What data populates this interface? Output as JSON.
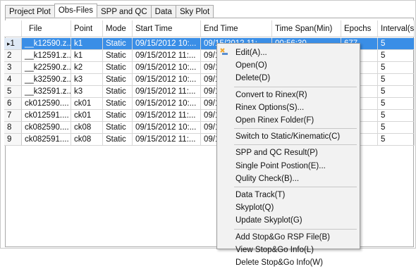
{
  "tabs": [
    {
      "label": "Project Plot",
      "active": false
    },
    {
      "label": "Obs-Files",
      "active": true
    },
    {
      "label": "SPP and QC",
      "active": false
    },
    {
      "label": "Data",
      "active": false
    },
    {
      "label": "Sky Plot",
      "active": false
    }
  ],
  "table": {
    "columns": [
      "File",
      "Point",
      "Mode",
      "Start Time",
      "End Time",
      "Time Span(Min)",
      "Epochs",
      "Interval(s)"
    ],
    "selected_row_marker": "▸",
    "rows": [
      {
        "num": "1",
        "file": "__k12590.z...",
        "point": "k1",
        "mode": "Static",
        "start": "09/15/2012 10:...",
        "end": "09/15/2012 11:...",
        "span": "00:56:30",
        "epochs": "677",
        "interval": "5"
      },
      {
        "num": "2",
        "file": "__k12591.z...",
        "point": "k1",
        "mode": "Static",
        "start": "09/15/2012 11:...",
        "end": "09/1",
        "span": "",
        "epochs": "",
        "interval": "5"
      },
      {
        "num": "3",
        "file": "__k22590.z...",
        "point": "k2",
        "mode": "Static",
        "start": "09/15/2012 10:...",
        "end": "09/1",
        "span": "",
        "epochs": "",
        "interval": "5"
      },
      {
        "num": "4",
        "file": "__k32590.z...",
        "point": "k3",
        "mode": "Static",
        "start": "09/15/2012 10:...",
        "end": "09/1",
        "span": "",
        "epochs": "",
        "interval": "5"
      },
      {
        "num": "5",
        "file": "__k32591.z...",
        "point": "k3",
        "mode": "Static",
        "start": "09/15/2012 11:...",
        "end": "09/1",
        "span": "",
        "epochs": "",
        "interval": "5"
      },
      {
        "num": "6",
        "file": "ck012590....",
        "point": "ck01",
        "mode": "Static",
        "start": "09/15/2012 10:...",
        "end": "09/1",
        "span": "",
        "epochs": "",
        "interval": "5"
      },
      {
        "num": "7",
        "file": "ck012591....",
        "point": "ck01",
        "mode": "Static",
        "start": "09/15/2012 11:...",
        "end": "09/1",
        "span": "",
        "epochs": "",
        "interval": "5"
      },
      {
        "num": "8",
        "file": "ck082590....",
        "point": "ck08",
        "mode": "Static",
        "start": "09/15/2012 10:...",
        "end": "09/1",
        "span": "",
        "epochs": "",
        "interval": "5"
      },
      {
        "num": "9",
        "file": "ck082591....",
        "point": "ck08",
        "mode": "Static",
        "start": "09/15/2012 11:...",
        "end": "09/1",
        "span": "",
        "epochs": "",
        "interval": "5"
      }
    ]
  },
  "context_menu": {
    "icon": "edit-icon",
    "groups": [
      [
        "Edit(A)...",
        "Open(O)",
        "Delete(D)"
      ],
      [
        "Convert to Rinex(R)",
        "Rinex Options(S)...",
        "Open Rinex Folder(F)"
      ],
      [
        "Switch to Static/Kinematic(C)"
      ],
      [
        "SPP and QC Result(P)",
        "Single Point Postion(E)...",
        "Qulity Check(B)..."
      ],
      [
        "Data Track(T)",
        "Skyplot(Q)",
        "Update Skyplot(G)"
      ],
      [
        "Add Stop&Go RSP File(B)",
        "View Stop&Go Info(L)",
        "Delete Stop&Go Info(W)"
      ]
    ]
  },
  "colors": {
    "selection": "#3a8ee6",
    "menu_bg": "#f2f2f2",
    "icon_accent": "#f0a830"
  }
}
